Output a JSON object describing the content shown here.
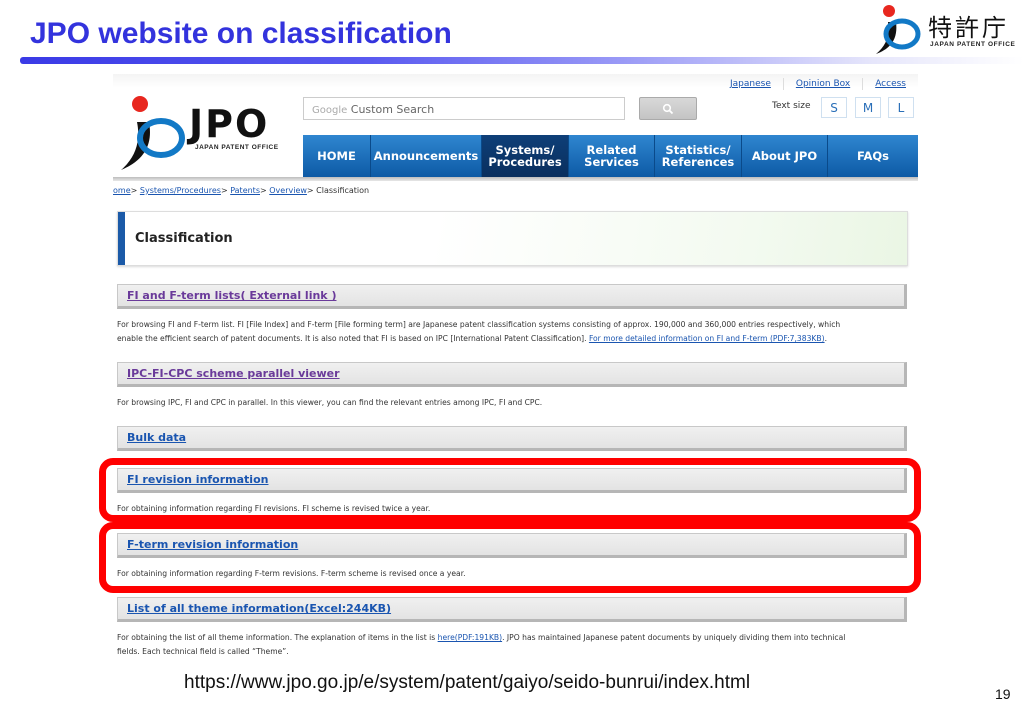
{
  "slide": {
    "title": "JPO website on classification",
    "logo_kanji": "特許庁",
    "logo_subtitle": "JAPAN PATENT OFFICE",
    "footer_url": "https://www.jpo.go.jp/e/system/patent/gaiyo/seido-bunrui/index.html",
    "page_number": "19",
    "colors": {
      "title": "#3333dd",
      "highlight": "#ff0000"
    }
  },
  "site": {
    "logo_text": "JPO",
    "logo_subtitle": "JAPAN PATENT OFFICE",
    "top_links": [
      "Japanese",
      "Opinion Box",
      "Access"
    ],
    "search": {
      "placeholder_brand": "Google",
      "placeholder_text": "Custom Search",
      "button_icon": "search-icon"
    },
    "text_size": {
      "label": "Text size",
      "options": [
        "S",
        "M",
        "L"
      ]
    },
    "nav": [
      {
        "label": "HOME",
        "active": false
      },
      {
        "label": "Announcements",
        "active": false
      },
      {
        "label": "Systems/ Procedures",
        "active": true
      },
      {
        "label": "Related Services",
        "active": false
      },
      {
        "label": "Statistics/ References",
        "active": false
      },
      {
        "label": "About JPO",
        "active": false
      },
      {
        "label": "FAQs",
        "active": false
      }
    ],
    "breadcrumb": {
      "links": [
        "Home",
        "Systems/Procedures",
        "Patents",
        "Overview"
      ],
      "current": "Classification",
      "separator": "> "
    },
    "page_title": "Classification",
    "colors": {
      "nav": "#1a6ebd",
      "nav_active": "#0c3a6e",
      "link": "#1a55b0",
      "visited": "#6a3a9a"
    },
    "sections": [
      {
        "title": "FI and F-term lists( External link )",
        "desc_lines": [
          "For browsing FI and F-term list. FI [File Index] and F-term [File forming term] are Japanese patent classification systems consisting of approx. 190,000 and 360,000 entries respectively, which",
          "enable the efficient search of patent documents. It is also noted that FI is based on IPC [International Patent Classification]. "
        ],
        "desc_link": "For more detailed information on FI and F-term (PDF:7,383KB)",
        "desc_after": "."
      },
      {
        "title": "IPC-FI-CPC scheme parallel viewer",
        "desc_lines": [
          "For browsing IPC, FI and CPC in parallel. In this viewer, you can find the relevant entries among IPC, FI and CPC."
        ]
      },
      {
        "title": "Bulk data"
      },
      {
        "title": "FI revision information",
        "desc_lines": [
          "For obtaining information regarding FI revisions. FI scheme is revised twice a year."
        ],
        "highlighted": true
      },
      {
        "title": "F-term revision information",
        "desc_lines": [
          "For obtaining information regarding F-term revisions. F-term scheme is revised once a year."
        ],
        "highlighted": true
      },
      {
        "title": "List of all theme information(Excel:244KB)",
        "desc_before": "For obtaining the list of all theme information. The explanation of items in the list is ",
        "desc_link": "here(PDF:191KB)",
        "desc_after": ". JPO has maintained Japanese patent documents by uniquely dividing them into technical",
        "desc_line2": "fields. Each technical field is called “Theme”."
      }
    ]
  }
}
